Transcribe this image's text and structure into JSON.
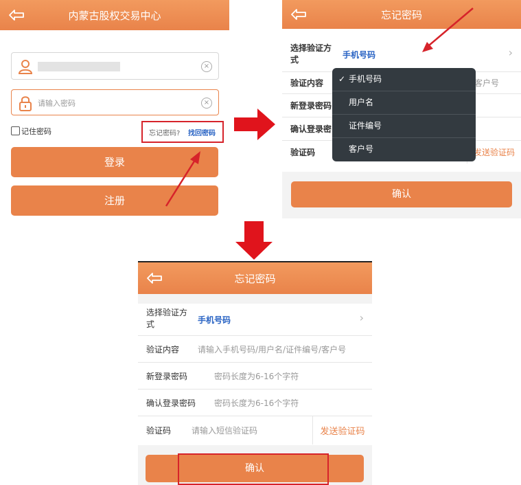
{
  "login": {
    "title": "内蒙古股权交易中心",
    "password_placeholder": "请输入密码",
    "remember_label": "记住密码",
    "forgot_label": "忘记密码?",
    "recover_link": "找回密码",
    "login_button": "登录",
    "register_button": "注册"
  },
  "forgot": {
    "title": "忘记密码",
    "method_label": "选择验证方式",
    "method_value": "手机号码",
    "content_label": "验证内容",
    "content_placeholder": "请输入手机号码/用户名/证件编号/客户号",
    "newpwd_label": "新登录密码",
    "newpwd_placeholder": "密码长度为6-16个字符",
    "confirmpwd_label": "确认登录密码",
    "confirmpwd_placeholder": "密码长度为6-16个字符",
    "code_label": "验证码",
    "code_placeholder": "请输入短信验证码",
    "send_code": "发送验证码",
    "confirm_button": "确认",
    "partial_content": "客户号",
    "partial_confirm_label": "确认登录密",
    "dropdown": [
      "手机号码",
      "用户名",
      "证件编号",
      "客户号"
    ],
    "check_mark": "✓"
  },
  "icons": {
    "clear": "×",
    "chevron": "›"
  },
  "colors": {
    "accent": "#e9834a",
    "link": "#2a64c4",
    "annotation": "#d6232a"
  }
}
